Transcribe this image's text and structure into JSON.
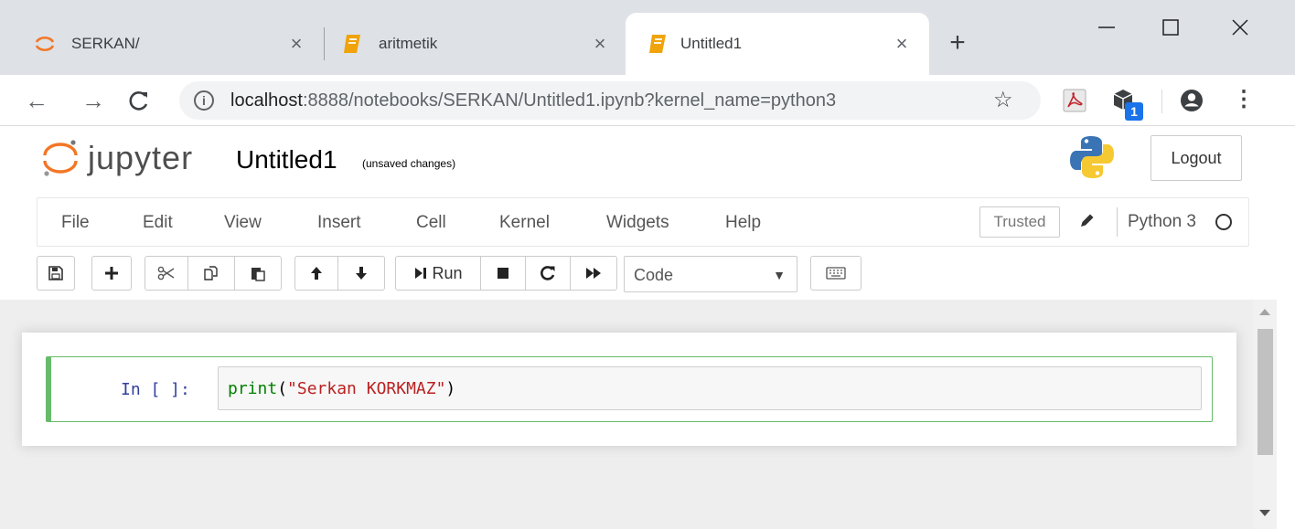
{
  "browser": {
    "tabs": [
      {
        "title": "SERKAN/",
        "icon": "jupyter-icon",
        "active": false
      },
      {
        "title": "aritmetik",
        "icon": "notebook-icon",
        "active": false
      },
      {
        "title": "Untitled1",
        "icon": "notebook-icon",
        "active": true
      }
    ],
    "tab_close": "×",
    "new_tab": "+",
    "window_controls": {
      "minimize": "—",
      "maximize": "☐",
      "close": "✕"
    },
    "nav": {
      "back": "←",
      "forward": "→",
      "reload": "C"
    },
    "url_host": "localhost",
    "url_rest": ":8888/notebooks/SERKAN/Untitled1.ipynb?kernel_name=python3",
    "star": "☆",
    "extension_badge": "1",
    "menu": "⋮",
    "colors": {
      "tabstrip": "#dee1e6",
      "accent": "#f37626"
    }
  },
  "jupyter": {
    "logo_text": "jupyter",
    "notebook_title": "Untitled1",
    "save_status": "(unsaved changes)",
    "logout_label": "Logout",
    "menu": [
      "File",
      "Edit",
      "View",
      "Insert",
      "Cell",
      "Kernel",
      "Widgets",
      "Help"
    ],
    "trusted_label": "Trusted",
    "kernel_name": "Python 3",
    "toolbar": {
      "run_label": "Run",
      "cell_type": "Code"
    },
    "cell": {
      "prompt": "In [ ]:",
      "code_func": "print",
      "code_open": "(",
      "code_string": "\"Serkan KORKMAZ\"",
      "code_close": ")"
    }
  }
}
